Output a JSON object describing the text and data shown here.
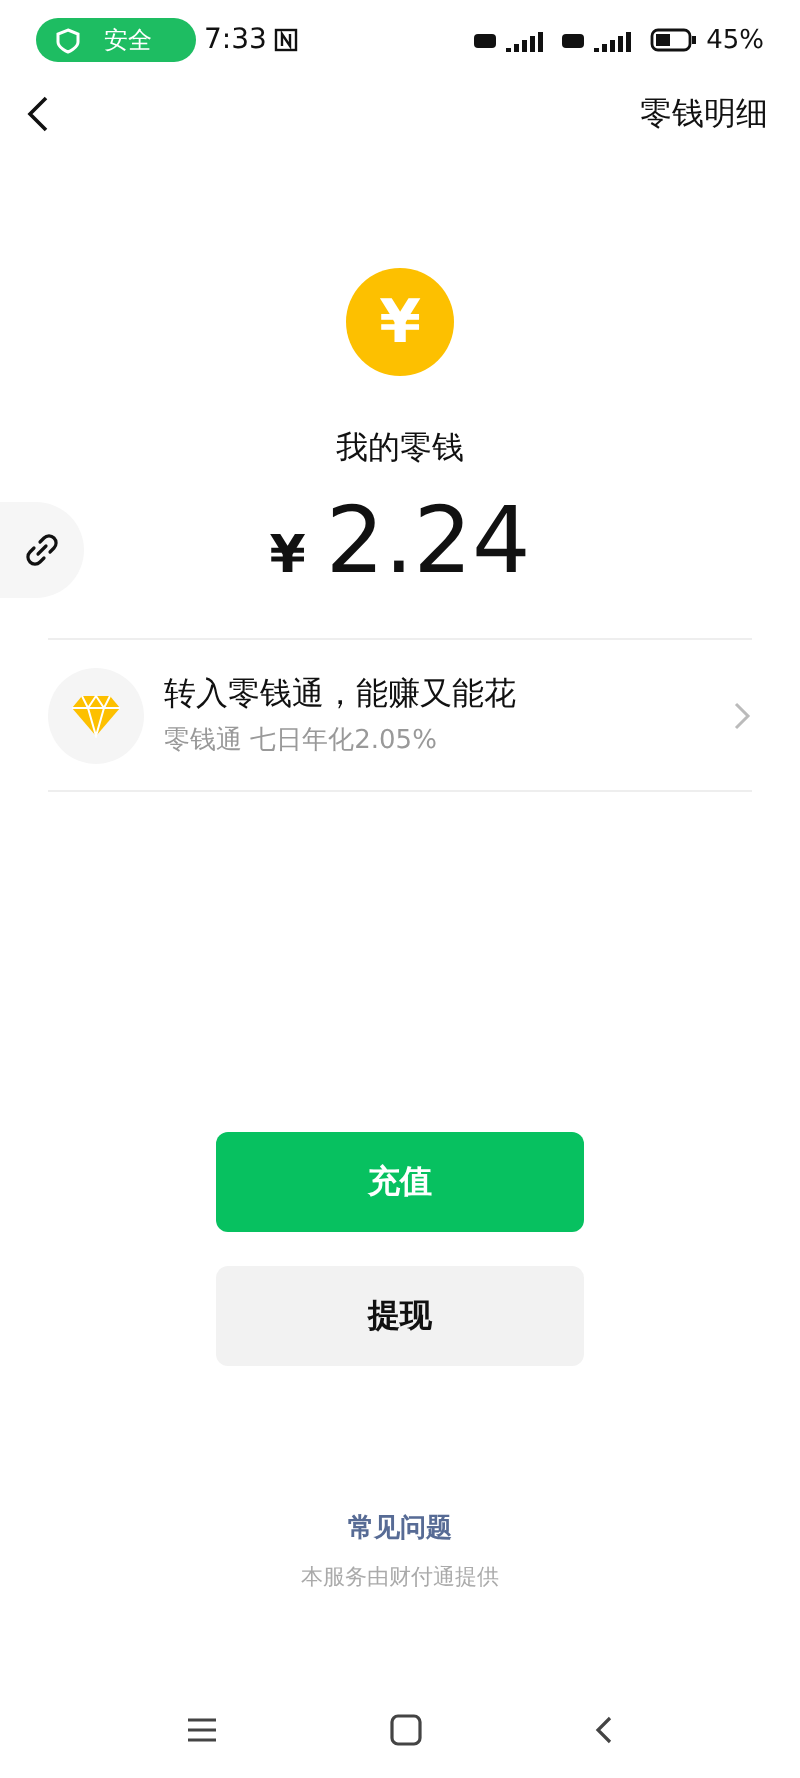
{
  "status_bar": {
    "security_badge": "安全",
    "time": "7:33",
    "battery_percent": "45%"
  },
  "nav": {
    "title": "零钱明细"
  },
  "balance": {
    "coin_symbol": "¥",
    "label": "我的零钱",
    "currency": "¥",
    "amount": "2.24"
  },
  "promo": {
    "title": "转入零钱通，能赚又能花",
    "subtitle": "零钱通 七日年化2.05%"
  },
  "buttons": [
    {
      "label": "充值",
      "kind": "primary"
    },
    {
      "label": "提现",
      "kind": "secondary"
    }
  ],
  "footer": {
    "faq_link": "常见问题",
    "provider": "本服务由财付通提供"
  }
}
